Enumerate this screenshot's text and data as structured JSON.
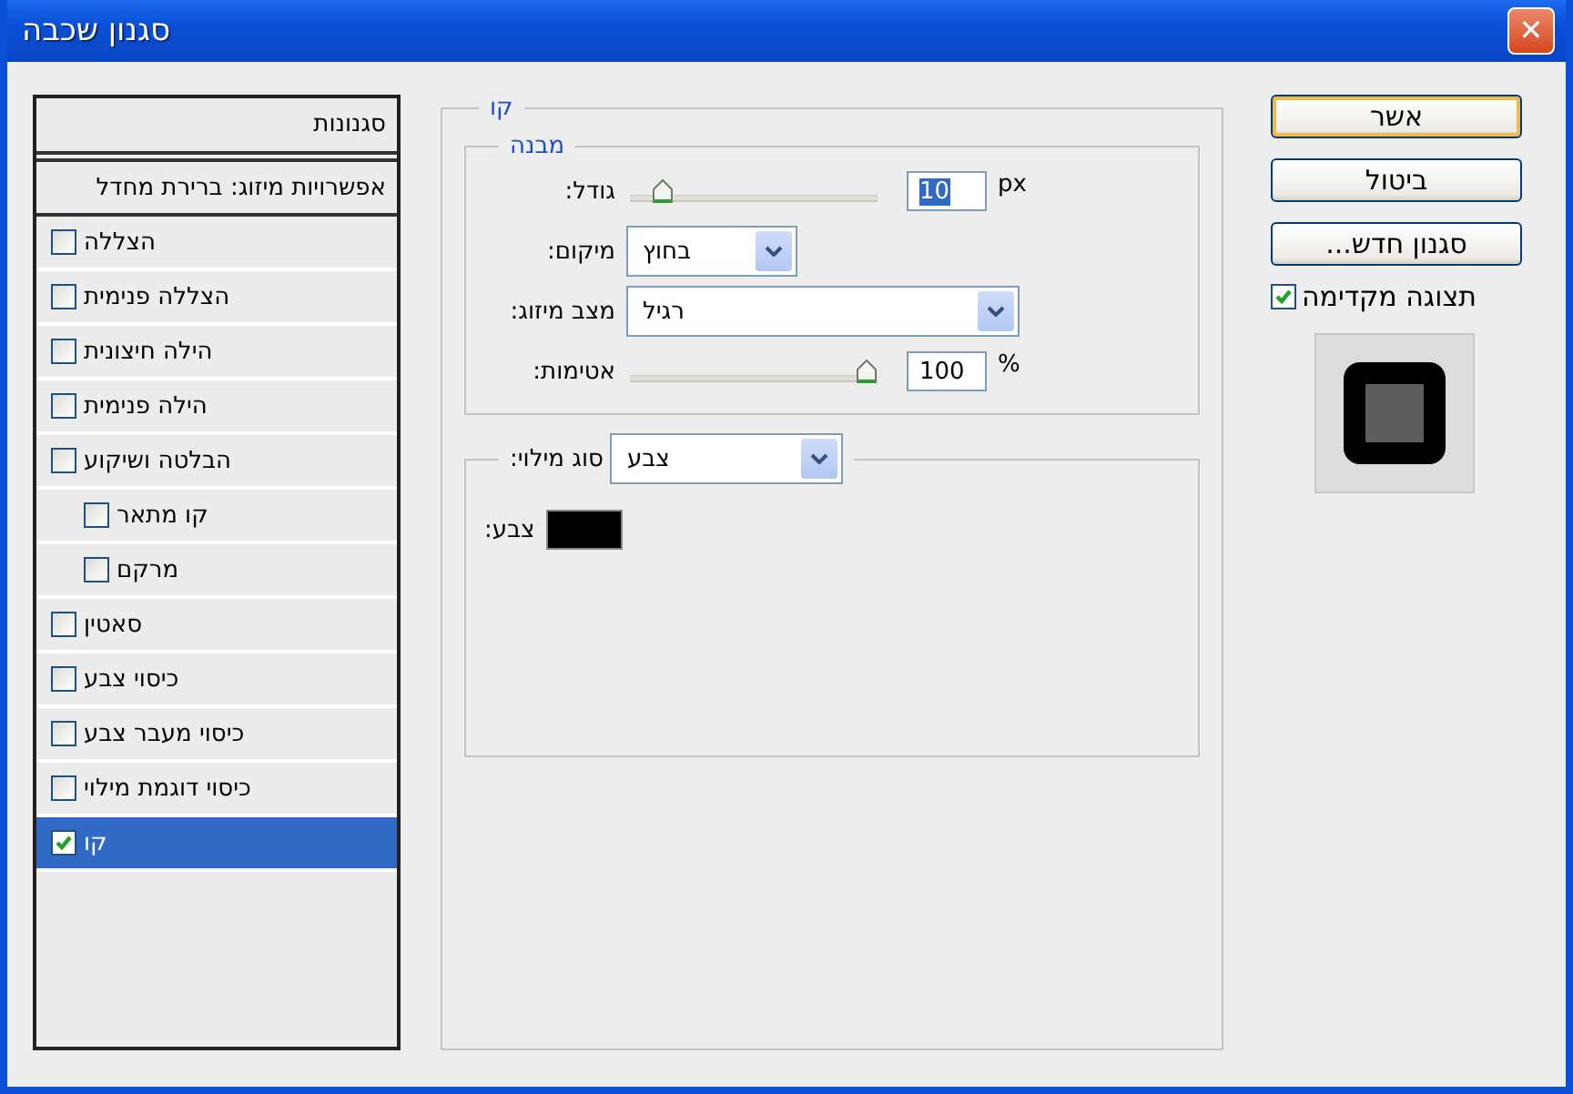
{
  "window": {
    "title": "סגנון שכבה",
    "close": "✕"
  },
  "sidebar": {
    "header": "סגנונות",
    "blending": "אפשרויות מיזוג: ברירת מחדל",
    "effects": [
      {
        "label": "הצללה",
        "checked": false,
        "selected": false
      },
      {
        "label": "הצללה פנימית",
        "checked": false,
        "selected": false
      },
      {
        "label": "הילה חיצונית",
        "checked": false,
        "selected": false
      },
      {
        "label": "הילה פנימית",
        "checked": false,
        "selected": false
      },
      {
        "label": "הבלטה ושיקוע",
        "checked": false,
        "selected": false,
        "children": [
          {
            "label": "קו מתאר",
            "checked": false,
            "selected": false
          },
          {
            "label": "מרקם",
            "checked": false,
            "selected": false
          }
        ]
      },
      {
        "label": "סאטין",
        "checked": false,
        "selected": false
      },
      {
        "label": "כיסוי צבע",
        "checked": false,
        "selected": false
      },
      {
        "label": "כיסוי מעבר צבע",
        "checked": false,
        "selected": false
      },
      {
        "label": "כיסוי דוגמת מילוי",
        "checked": false,
        "selected": false
      },
      {
        "label": "קו",
        "checked": true,
        "selected": true
      }
    ]
  },
  "panel": {
    "title": "קו",
    "structure": {
      "title": "מבנה",
      "size": {
        "label": "גודל:",
        "level": 0.1,
        "value": "10",
        "unit": "px"
      },
      "position": {
        "label": "מיקום:",
        "value": "בחוץ"
      },
      "blend_mode": {
        "label": "מצב מיזוג:",
        "value": "רגיל"
      },
      "opacity": {
        "label": "אטימות:",
        "level": 1,
        "value": "100",
        "unit": "%"
      }
    },
    "fill": {
      "label": "סוג מילוי:",
      "value": "צבע",
      "color_label": "צבע:"
    }
  },
  "buttons": [
    {
      "label": "אשר",
      "default": true
    },
    {
      "label": "ביטול",
      "default": false
    },
    {
      "label": "סגנון חדש...",
      "default": false
    }
  ],
  "preview": {
    "label": "תצוגה מקדימה",
    "checked": true
  }
}
